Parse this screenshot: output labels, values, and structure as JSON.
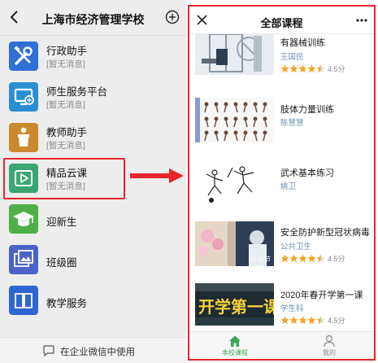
{
  "left": {
    "title": "上海市经济管理学校",
    "apps": [
      {
        "name": "行政助手",
        "sub": "[暂无消息]",
        "icon": "tools-icon",
        "color": "#2f6fd6"
      },
      {
        "name": "师生服务平台",
        "sub": "[暂无消息]",
        "icon": "monitor-icon",
        "color": "#2a8fd1"
      },
      {
        "name": "教师助手",
        "sub": "[暂无消息]",
        "icon": "podium-icon",
        "color": "#c98a2e"
      },
      {
        "name": "精品云课",
        "sub": "[暂无消息]",
        "icon": "play-icon",
        "color": "#3aa673"
      },
      {
        "name": "迎新生",
        "sub": "",
        "icon": "graduation-cap-icon",
        "color": "#4fb049"
      },
      {
        "name": "班级圈",
        "sub": "",
        "icon": "gallery-icon",
        "color": "#4b63c9"
      },
      {
        "name": "教学服务",
        "sub": "",
        "icon": "book-icon",
        "color": "#2d66d0"
      }
    ],
    "footer": "在企业微信中使用"
  },
  "right": {
    "title": "全部课程",
    "courses": [
      {
        "title": "有器械训练",
        "teacher": "王国民",
        "rating": 4.5,
        "score": "4.5分",
        "badge": ""
      },
      {
        "title": "肢体力量训练",
        "teacher": "陈慧慧",
        "rating": null,
        "score": "",
        "badge": ""
      },
      {
        "title": "武术基本练习",
        "teacher": "姚卫",
        "rating": null,
        "score": "",
        "badge": ""
      },
      {
        "title": "安全防护新型冠状病毒",
        "teacher": "公共卫生",
        "rating": 4.5,
        "score": "4.5分",
        "badge": "32 小节"
      },
      {
        "title": "2020年春开学第一课",
        "teacher": "学生科",
        "rating": 4.5,
        "score": "4.5分",
        "badge": "",
        "thumb_text": "开学第一课"
      }
    ],
    "tabs": [
      {
        "label": "本校课程",
        "active": true
      },
      {
        "label": "我的",
        "active": false
      }
    ]
  },
  "colors": {
    "highlight": "#e8252b",
    "star": "#f5a623",
    "active_tab": "#3aa657"
  }
}
